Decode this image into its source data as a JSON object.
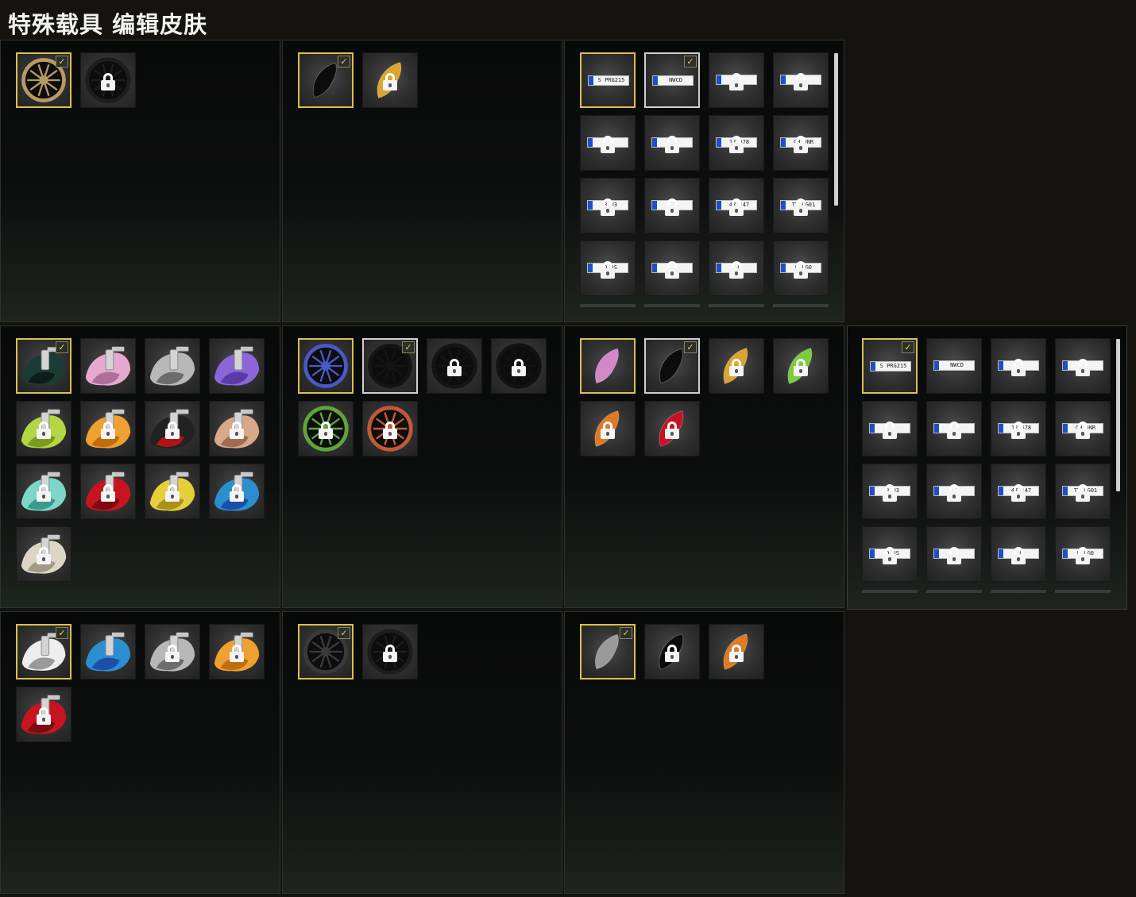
{
  "title": "特殊载具 编辑皮肤",
  "colors": {
    "equipped": "#d8c34a",
    "selected": "#cfcfcf",
    "plate_band": "#1e4fc4"
  },
  "panels": [
    {
      "id": "p1",
      "kind": "wheel",
      "slots": [
        {
          "art": "wheel-gold",
          "equipped": true,
          "check": true,
          "locked": false
        },
        {
          "art": "wheel-black",
          "locked": true
        }
      ]
    },
    {
      "id": "p2",
      "kind": "caliper",
      "slots": [
        {
          "art": "caliper-black",
          "equipped": true,
          "check": true,
          "locked": false
        },
        {
          "art": "caliper-gold",
          "locked": true
        }
      ]
    },
    {
      "id": "p3",
      "kind": "plate",
      "slots": [
        {
          "plate": "S PRG215",
          "equipped": true,
          "locked": false
        },
        {
          "plate": "NWCD",
          "selected": true,
          "check": true,
          "locked": false
        },
        {
          "plate": "",
          "locked": true
        },
        {
          "plate": "",
          "locked": true
        },
        {
          "plate": "",
          "locked": true
        },
        {
          "plate": "",
          "locked": true
        },
        {
          "plate": "12 678",
          "locked": true
        },
        {
          "plate": "CH DNR",
          "locked": true
        },
        {
          "plate": "R N3",
          "locked": true
        },
        {
          "plate": "1",
          "locked": true
        },
        {
          "plate": "47 147",
          "locked": true
        },
        {
          "plate": "TY 0G01",
          "locked": true
        },
        {
          "plate": "D RS",
          "locked": true
        },
        {
          "plate": "",
          "locked": true
        },
        {
          "plate": "G",
          "locked": true
        },
        {
          "plate": "N 0G0",
          "locked": true
        }
      ]
    },
    {
      "id": "p4",
      "kind": "paint",
      "slots": [
        {
          "art": "paint-darkteal",
          "equipped": true,
          "check": true,
          "locked": false
        },
        {
          "art": "paint-pink",
          "locked": false
        },
        {
          "art": "paint-gray",
          "locked": false
        },
        {
          "art": "paint-purple",
          "locked": false
        },
        {
          "art": "paint-lime",
          "locked": true
        },
        {
          "art": "paint-orange",
          "locked": true
        },
        {
          "art": "paint-blackred",
          "locked": true
        },
        {
          "art": "paint-tan",
          "locked": true
        },
        {
          "art": "paint-aqua",
          "locked": true
        },
        {
          "art": "paint-red",
          "locked": true
        },
        {
          "art": "paint-yellow",
          "locked": true
        },
        {
          "art": "paint-blue",
          "locked": true
        },
        {
          "art": "paint-cream",
          "locked": true
        }
      ]
    },
    {
      "id": "p5",
      "kind": "wheel",
      "slots": [
        {
          "art": "wheel-blue",
          "equipped": true,
          "locked": false
        },
        {
          "art": "wheel-black-spoke",
          "selected": true,
          "check": true,
          "locked": false
        },
        {
          "art": "wheel-black2",
          "locked": true
        },
        {
          "art": "wheel-black3",
          "locked": true
        },
        {
          "art": "wheel-green",
          "locked": true
        },
        {
          "art": "wheel-copper",
          "locked": true
        }
      ]
    },
    {
      "id": "p6",
      "kind": "caliper",
      "slots": [
        {
          "art": "caliper-pink",
          "equipped": true,
          "locked": false
        },
        {
          "art": "caliper-black",
          "selected": true,
          "check": true,
          "locked": false
        },
        {
          "art": "caliper-gold",
          "locked": true
        },
        {
          "art": "caliper-green",
          "locked": true
        },
        {
          "art": "caliper-orange",
          "locked": true
        },
        {
          "art": "caliper-red",
          "locked": true
        }
      ]
    },
    {
      "id": "p7",
      "kind": "paint",
      "slots": [
        {
          "art": "paint-white",
          "equipped": true,
          "check": true,
          "locked": false
        },
        {
          "art": "paint-blue",
          "locked": false
        },
        {
          "art": "paint-gray",
          "locked": true
        },
        {
          "art": "paint-orange",
          "locked": true
        },
        {
          "art": "paint-red",
          "locked": true
        }
      ]
    },
    {
      "id": "p8",
      "kind": "wheel",
      "slots": [
        {
          "art": "wheel-darkgray",
          "equipped": true,
          "check": true,
          "locked": false
        },
        {
          "art": "wheel-black",
          "locked": true
        }
      ]
    },
    {
      "id": "p9",
      "kind": "caliper",
      "slots": [
        {
          "art": "caliper-silver",
          "equipped": true,
          "check": true,
          "locked": false
        },
        {
          "art": "caliper-black",
          "locked": true
        },
        {
          "art": "caliper-orange",
          "locked": true
        }
      ]
    }
  ],
  "side_panel": {
    "kind": "plate",
    "slots": [
      {
        "plate": "S PRG215",
        "equipped": true,
        "check": true,
        "locked": false
      },
      {
        "plate": "NWCD",
        "locked": false
      },
      {
        "plate": "",
        "locked": true
      },
      {
        "plate": "",
        "locked": true
      },
      {
        "plate": "",
        "locked": true
      },
      {
        "plate": "",
        "locked": true
      },
      {
        "plate": "12 678",
        "locked": true
      },
      {
        "plate": "CH DNR",
        "locked": true
      },
      {
        "plate": "R N3",
        "locked": true
      },
      {
        "plate": "1",
        "locked": true
      },
      {
        "plate": "47 147",
        "locked": true
      },
      {
        "plate": "TY 0G01",
        "locked": true
      },
      {
        "plate": "D RS",
        "locked": true
      },
      {
        "plate": "",
        "locked": true
      },
      {
        "plate": "G",
        "locked": true
      },
      {
        "plate": "N 0G0",
        "locked": true
      }
    ]
  }
}
